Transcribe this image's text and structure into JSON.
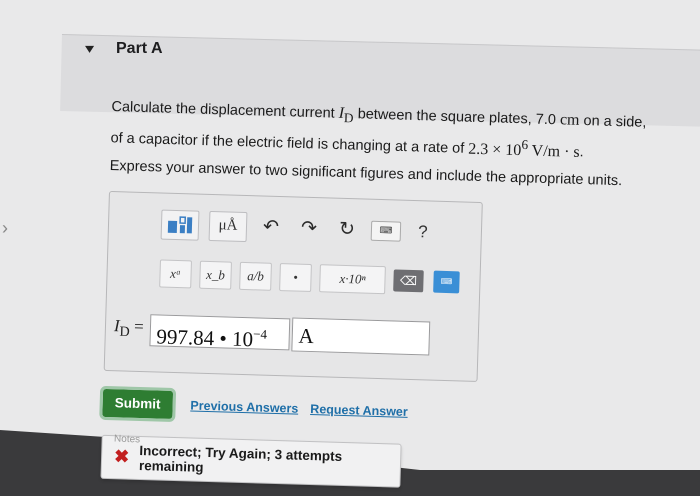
{
  "section": {
    "title": "Part A",
    "nav_arrow": "›"
  },
  "question": {
    "line1_pre": "Calculate the displacement current ",
    "symbol_I": "I",
    "symbol_D": "D",
    "line1_mid": " between the square plates, 7.0 ",
    "unit_cm": "cm",
    "line1_post": " on a side,",
    "line2_pre": "of a capacitor if the electric field is changing at a rate of ",
    "rate_mantissa": "2.3 × 10",
    "rate_exp": "6",
    "rate_unit": " V/m · s",
    "line2_post": ".",
    "instruction": "Express your answer to two significant figures and include the appropriate units."
  },
  "toolbar": {
    "templates_icon": "templates-icon",
    "units_label": "μÅ",
    "undo_glyph": "↶",
    "redo_glyph": "↷",
    "reset_glyph": "↻",
    "keyboard_label": "⌨",
    "help_label": "?",
    "superscript_label": "xᵃ",
    "subscript_label": "x_b",
    "fraction_label": "a/b",
    "dot_label": "•",
    "sci_label": "x·10ⁿ",
    "delete_label": "⌫",
    "keyboard2_label": "⌨"
  },
  "answer": {
    "label_I": "I",
    "label_D": "D",
    "label_eq": " =",
    "value_mantissa": "997.84 • 10",
    "value_exp": "−4",
    "unit": "A"
  },
  "actions": {
    "submit_label": "Submit",
    "previous_label": "Previous Answers",
    "request_label": "Request Answer"
  },
  "feedback": {
    "icon": "✖",
    "text": "Incorrect; Try Again; 3 attempts remaining"
  },
  "notes_label": "Notes"
}
